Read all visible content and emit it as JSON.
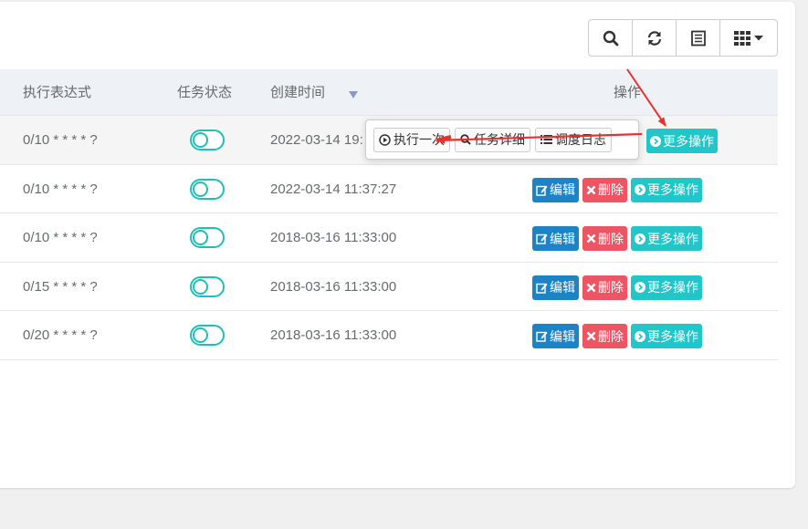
{
  "toolbar": {
    "search_icon": "search-icon",
    "refresh_icon": "refresh-icon",
    "export_icon": "list-icon",
    "columns_icon": "grid-icon"
  },
  "table": {
    "headers": {
      "cron": "执行表达式",
      "status": "任务状态",
      "created": "创建时间",
      "ops": "操作"
    },
    "rows": [
      {
        "cron": "0/10 * * * * ?",
        "created": "2022-03-14 19:",
        "status_on": true
      },
      {
        "cron": "0/10 * * * * ?",
        "created": "2022-03-14 11:37:27",
        "status_on": true
      },
      {
        "cron": "0/10 * * * * ?",
        "created": "2018-03-16 11:33:00",
        "status_on": true
      },
      {
        "cron": "0/15 * * * * ?",
        "created": "2018-03-16 11:33:00",
        "status_on": true
      },
      {
        "cron": "0/20 * * * * ?",
        "created": "2018-03-16 11:33:00",
        "status_on": true
      }
    ]
  },
  "actions": {
    "edit": "编辑",
    "delete": "删除",
    "more": "更多操作"
  },
  "popover": {
    "run_once": "执行一次",
    "task_detail": "任务详细",
    "schedule_log": "调度日志"
  },
  "colors": {
    "edit": "#1c84c6",
    "delete": "#ed5565",
    "more": "#23c6c8",
    "toggle": "#1fbfb8",
    "arrow": "#e8312f"
  }
}
